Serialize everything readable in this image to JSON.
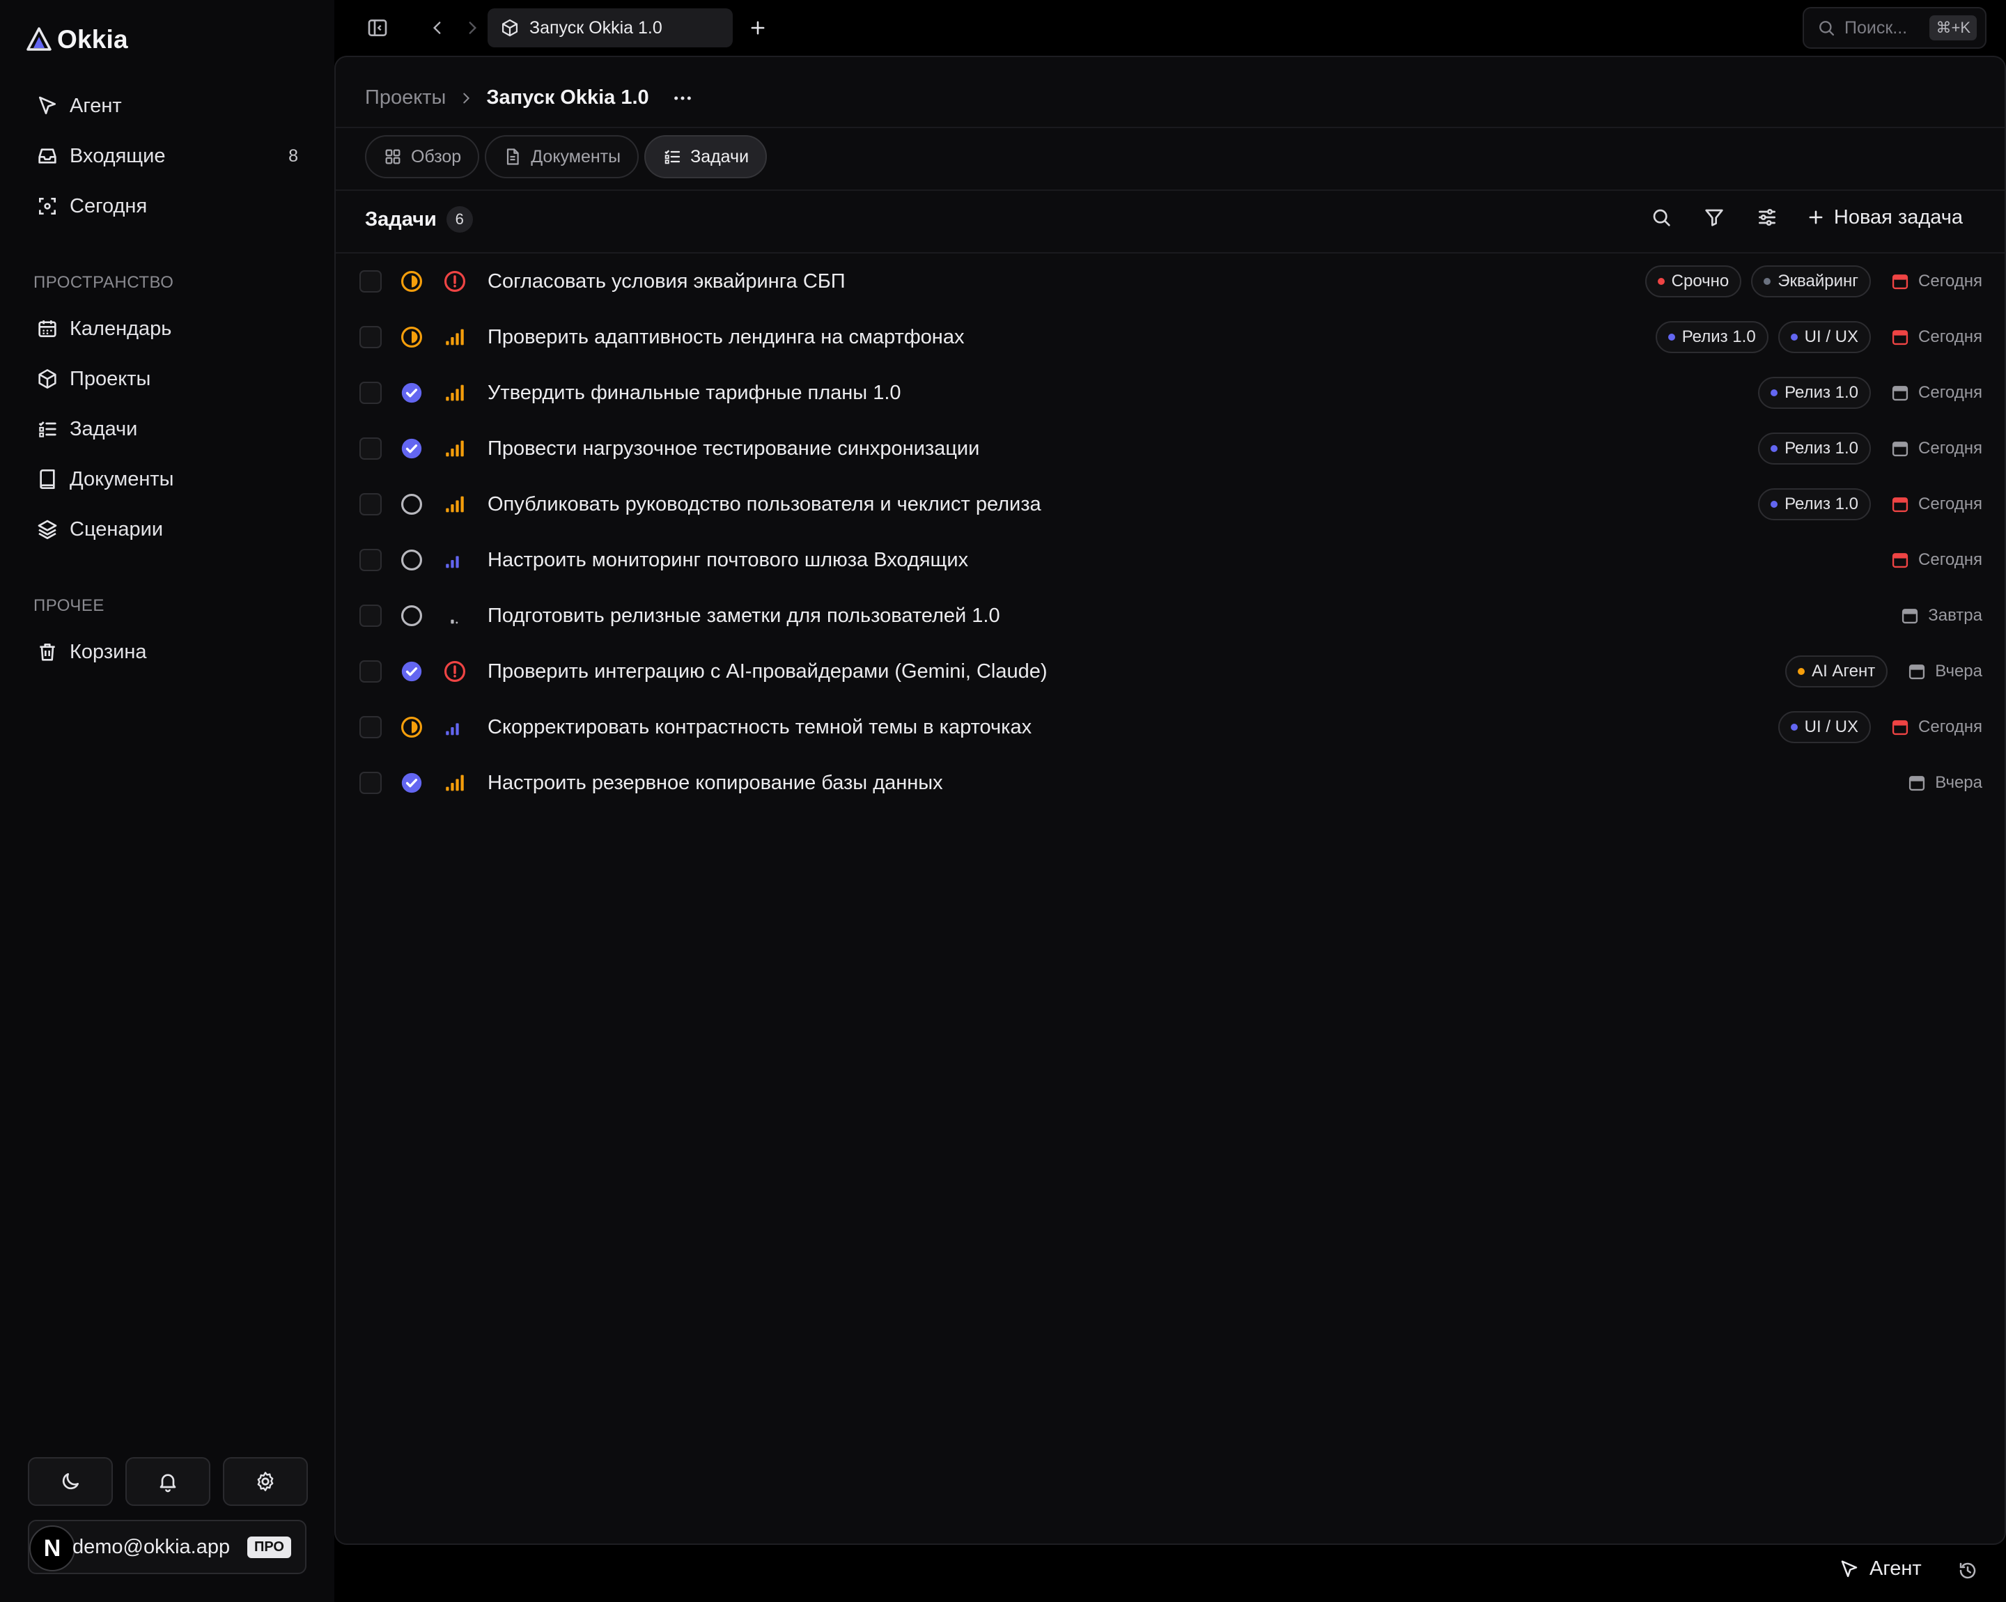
{
  "app": {
    "name": "Okkia",
    "accent": "#6366f1"
  },
  "sidebar": {
    "nav": [
      {
        "label": "Агент",
        "icon": "cursor-icon"
      },
      {
        "label": "Входящие",
        "icon": "inbox-icon",
        "badge": "8"
      },
      {
        "label": "Сегодня",
        "icon": "focus-icon"
      }
    ],
    "workspace_title": "ПРОСТРАНСТВО",
    "workspace": [
      {
        "label": "Календарь",
        "icon": "calendar-icon"
      },
      {
        "label": "Проекты",
        "icon": "cube-icon"
      },
      {
        "label": "Задачи",
        "icon": "list-check-icon"
      },
      {
        "label": "Документы",
        "icon": "book-icon"
      },
      {
        "label": "Сценарии",
        "icon": "layers-icon"
      }
    ],
    "other_title": "ПРОЧЕЕ",
    "other": [
      {
        "label": "Корзина",
        "icon": "trash-icon"
      }
    ],
    "user": {
      "avatar": "N",
      "email": "demo@okkia.app",
      "plan": "ПРО"
    }
  },
  "topbar": {
    "tab_title": "Запуск Okkia 1.0",
    "search_placeholder": "Поиск...",
    "search_shortcut": "⌘+K"
  },
  "page": {
    "breadcrumb_root": "Проекты",
    "breadcrumb_current": "Запуск Okkia 1.0",
    "tabs": [
      {
        "label": "Обзор",
        "icon": "grid-icon",
        "active": false
      },
      {
        "label": "Документы",
        "icon": "document-icon",
        "active": false
      },
      {
        "label": "Задачи",
        "icon": "list-check-icon",
        "active": true
      }
    ],
    "tasks_title": "Задачи",
    "tasks_count": "6",
    "new_task_label": "Новая задача"
  },
  "tasks": [
    {
      "title": "Согласовать условия эквайринга СБП",
      "status": "in-progress",
      "priority": "urgent",
      "tags": [
        {
          "label": "Срочно",
          "color": "#ef4444"
        },
        {
          "label": "Эквайринг",
          "color": "#6b7280"
        }
      ],
      "date": "Сегодня",
      "date_color": "#ef4444"
    },
    {
      "title": "Проверить адаптивность лендинга на смартфонах",
      "status": "in-progress",
      "priority": "high",
      "tags": [
        {
          "label": "Релиз 1.0",
          "color": "#6366f1"
        },
        {
          "label": "UI / UX",
          "color": "#6366f1"
        }
      ],
      "date": "Сегодня",
      "date_color": "#ef4444"
    },
    {
      "title": "Утвердить финальные тарифные планы 1.0",
      "status": "done",
      "priority": "high",
      "tags": [
        {
          "label": "Релиз 1.0",
          "color": "#6366f1"
        }
      ],
      "date": "Сегодня",
      "date_color": "#9a9aa0"
    },
    {
      "title": "Провести нагрузочное тестирование синхронизации",
      "status": "done",
      "priority": "high",
      "tags": [
        {
          "label": "Релиз 1.0",
          "color": "#6366f1"
        }
      ],
      "date": "Сегодня",
      "date_color": "#9a9aa0"
    },
    {
      "title": "Опубликовать руководство пользователя и чеклист релиза",
      "status": "todo",
      "priority": "high",
      "tags": [
        {
          "label": "Релиз 1.0",
          "color": "#6366f1"
        }
      ],
      "date": "Сегодня",
      "date_color": "#ef4444"
    },
    {
      "title": "Настроить мониторинг почтового шлюза Входящих",
      "status": "todo",
      "priority": "medium",
      "tags": [],
      "date": "Сегодня",
      "date_color": "#ef4444"
    },
    {
      "title": "Подготовить релизные заметки для пользователей 1.0",
      "status": "todo",
      "priority": "low",
      "tags": [],
      "date": "Завтра",
      "date_color": "#9a9aa0"
    },
    {
      "title": "Проверить интеграцию с AI-провайдерами (Gemini, Claude)",
      "status": "done",
      "priority": "urgent",
      "tags": [
        {
          "label": "AI Агент",
          "color": "#f59e0b"
        }
      ],
      "date": "Вчера",
      "date_color": "#9a9aa0"
    },
    {
      "title": "Скорректировать контрастность темной темы в карточках",
      "status": "in-progress",
      "priority": "medium",
      "tags": [
        {
          "label": "UI / UX",
          "color": "#6366f1"
        }
      ],
      "date": "Сегодня",
      "date_color": "#ef4444"
    },
    {
      "title": "Настроить резервное копирование базы данных",
      "status": "done",
      "priority": "high",
      "tags": [],
      "date": "Вчера",
      "date_color": "#9a9aa0"
    }
  ],
  "bottombar": {
    "agent_label": "Агент"
  }
}
